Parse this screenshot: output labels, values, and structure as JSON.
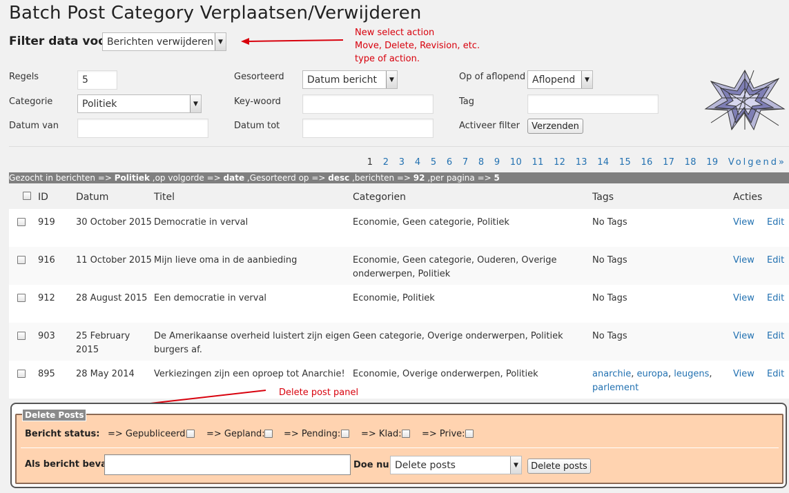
{
  "page": {
    "title": "Batch Post Category Verplaatsen/Verwijderen",
    "filter_label": "Filter data voor:",
    "filter_select": "Berichten verwijderen"
  },
  "annotations": {
    "select_note": [
      "New select action",
      "Move, Delete, Revision, etc.",
      "type of action."
    ],
    "panel_note": "Delete post panel",
    "color": "#d8000c"
  },
  "form": {
    "regels_label": "Regels",
    "regels_value": "5",
    "categorie_label": "Categorie",
    "categorie_value": "Politiek",
    "datum_van_label": "Datum van",
    "gesorteerd_label": "Gesorteerd",
    "gesorteerd_value": "Datum bericht",
    "keywoord_label": "Key-woord",
    "datum_tot_label": "Datum tot",
    "aflopend_label": "Op of aflopend",
    "aflopend_value": "Aflopend",
    "tag_label": "Tag",
    "activeer_label": "Activeer filter",
    "submit_label": "Verzenden"
  },
  "pagination": {
    "current": "1",
    "pages": [
      "2",
      "3",
      "4",
      "5",
      "6",
      "7",
      "8",
      "9",
      "10",
      "11",
      "12",
      "13",
      "14",
      "15",
      "16",
      "17",
      "18",
      "19"
    ],
    "next": "Volgend»"
  },
  "info": {
    "p1": "Gezocht in berichten => ",
    "cat": "Politiek",
    "p2": " ,op volgorde => ",
    "order": "date",
    "p3": " ,Gesorteerd op => ",
    "sort": "desc",
    "p4": " ,berichten => ",
    "count": "92",
    "p5": " ,per pagina => ",
    "per": "5"
  },
  "table": {
    "headers": {
      "id": "ID",
      "datum": "Datum",
      "titel": "Titel",
      "categorien": "Categorien",
      "tags": "Tags",
      "acties": "Acties"
    },
    "view_label": "View",
    "edit_label": "Edit",
    "rows": [
      {
        "id": "919",
        "datum": "30 October 2015",
        "titel": "Democratie in verval",
        "cats": "Economie, Geen categorie, Politiek",
        "tags": "No Tags"
      },
      {
        "id": "916",
        "datum": "11 October 2015",
        "titel": "Mijn lieve oma in de aanbieding",
        "cats": "Economie, Geen categorie, Ouderen, Overige onderwerpen, Politiek",
        "tags": "No Tags"
      },
      {
        "id": "912",
        "datum": "28 August 2015",
        "titel": "Een democratie in verval",
        "cats": "Economie, Politiek",
        "tags": "No Tags"
      },
      {
        "id": "903",
        "datum": "25 February 2015",
        "titel": "De Amerikaanse overheid luistert zijn eigen burgers af.",
        "cats": "Geen categorie, Overige onderwerpen, Politiek",
        "tags": "No Tags"
      },
      {
        "id": "895",
        "datum": "28 May 2014",
        "titel": "Verkiezingen zijn een oproep tot Anarchie!",
        "cats": "Economie, Overige onderwerpen, Politiek",
        "tag_links": [
          "anarchie",
          "europa",
          "leugens",
          "parlement"
        ]
      }
    ]
  },
  "delete_panel": {
    "legend": "Delete Posts",
    "status_label": "Bericht status:",
    "statuses": [
      "=> Gepubliceerd:",
      "=> Gepland:",
      "=> Pending:",
      "=> Klad:",
      "=> Prive:"
    ],
    "contains_label": "Als bericht bevat:",
    "doe_nu_label": "Doe nu:",
    "doe_nu_value": "Delete posts",
    "button_label": "Delete posts",
    "panel_color": "#ffd3b0"
  },
  "colors": {
    "link": "#2271b1",
    "infobar": "#7f7f7f"
  }
}
